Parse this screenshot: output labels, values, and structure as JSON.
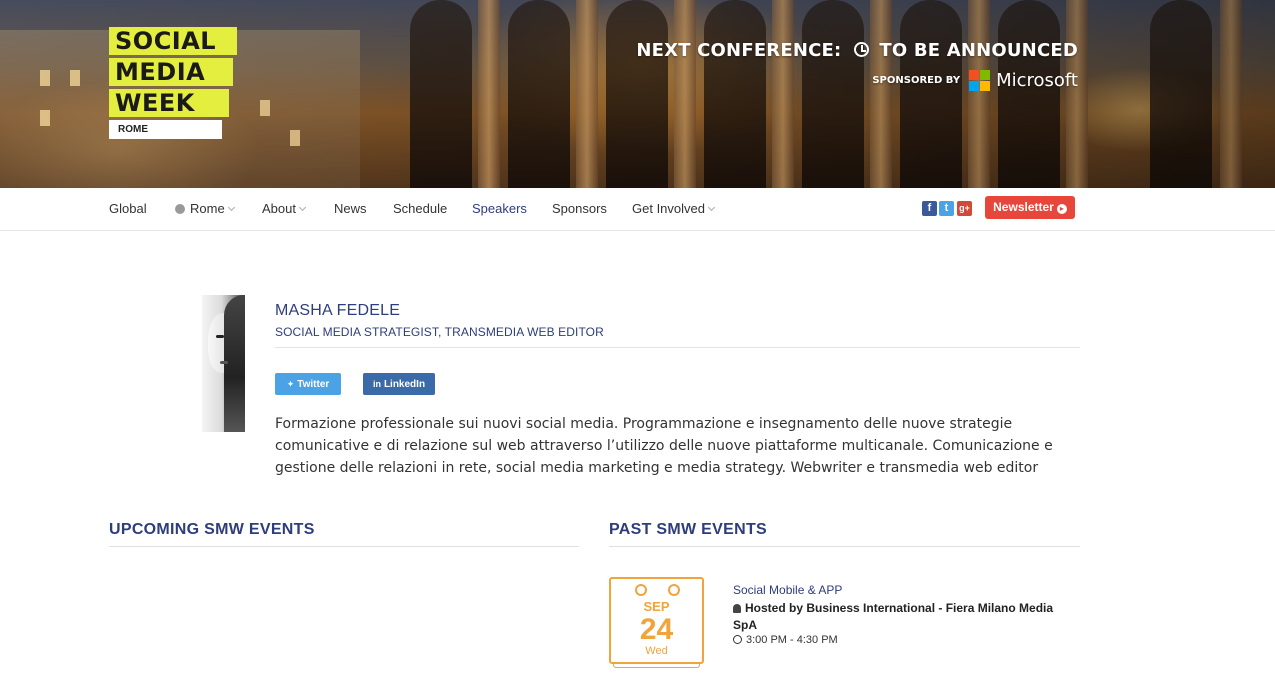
{
  "header": {
    "logo": {
      "line1": "SOCIAL",
      "line2": "MEDIA",
      "line3": "WEEK",
      "city": "ROME"
    },
    "next_conference_label": "NEXT CONFERENCE:",
    "next_conference_value": "TO BE ANNOUNCED",
    "sponsored_by": "SPONSORED BY",
    "sponsor_name": "Microsoft",
    "ms_colors": [
      "#f25022",
      "#7fba00",
      "#00a4ef",
      "#ffb900"
    ]
  },
  "nav": {
    "items": [
      {
        "label": "Global"
      },
      {
        "label": "Rome"
      },
      {
        "label": "About"
      },
      {
        "label": "News"
      },
      {
        "label": "Schedule"
      },
      {
        "label": "Speakers"
      },
      {
        "label": "Sponsors"
      },
      {
        "label": "Get Involved"
      }
    ],
    "social": {
      "facebook": "f",
      "twitter": "t",
      "google": "g+"
    },
    "newsletter_label": "Newsletter"
  },
  "speaker": {
    "name": "MASHA FEDELE",
    "title": "SOCIAL MEDIA STRATEGIST, TRANSMEDIA WEB EDITOR",
    "twitter_label": "Twitter",
    "linkedin_label": "LinkedIn",
    "bio": "Formazione professionale sui nuovi social media. Programmazione e insegnamento delle nuove strategie comunicative e di relazione sul web attraverso l’utilizzo delle nuove piattaforme multicanale. Comunicazione e gestione delle relazioni in rete, social media marketing e media strategy. Webwriter e transmedia web editor"
  },
  "events": {
    "upcoming_title": "UPCOMING SMW EVENTS",
    "past_title": "PAST SMW EVENTS",
    "past": [
      {
        "month": "SEP",
        "day": "24",
        "weekday": "Wed",
        "title": "Social Mobile & APP",
        "host": "Hosted by Business International - Fiera Milano Media SpA",
        "time": "3:00 PM - 4:30 PM"
      }
    ]
  },
  "colors": {
    "brand_navy": "#2d3d7d",
    "logo_yellow": "#e4ee3e",
    "newsletter_red": "#e8463b",
    "calendar_orange": "#f2a43c",
    "twitter_blue": "#4ba3e6",
    "linkedin_blue": "#3b6aa8"
  }
}
